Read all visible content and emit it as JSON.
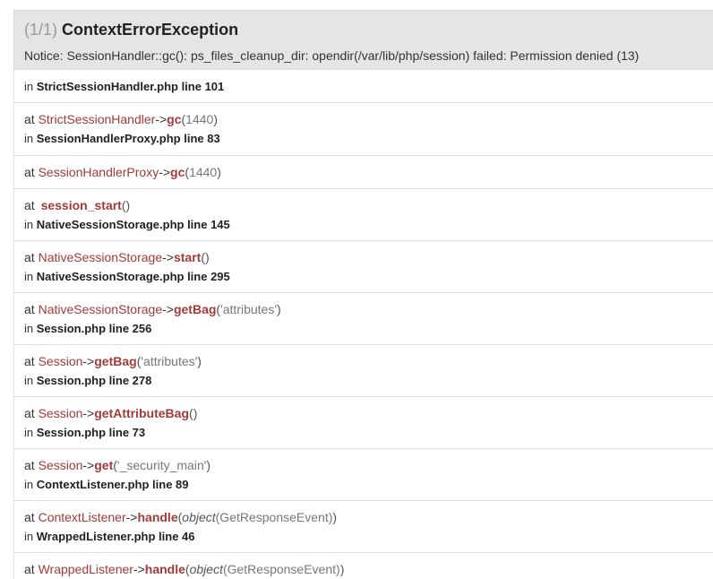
{
  "exception": {
    "count": "(1/1)",
    "name": "ContextErrorException",
    "message": "Notice: SessionHandler::gc(): ps_files_cleanup_dir: opendir(/var/lib/php/session) failed: Permission denied (13)"
  },
  "trace": [
    {
      "prefix": "in",
      "file": "StrictSessionHandler.php line 101"
    },
    {
      "prefix": "at",
      "cls": "StrictSessionHandler",
      "arrow": "->",
      "fn": "gc",
      "open": "(",
      "arg": "1440",
      "close": ")",
      "in": "in",
      "file": "SessionHandlerProxy.php line 83"
    },
    {
      "prefix": "at",
      "cls": "SessionHandlerProxy",
      "arrow": "->",
      "fn": "gc",
      "open": "(",
      "arg": "1440",
      "close": ")"
    },
    {
      "prefix": "at",
      "fn": "session_start",
      "open": "(",
      "close": ")",
      "in": "in",
      "file": "NativeSessionStorage.php line 145"
    },
    {
      "prefix": "at",
      "cls": "NativeSessionStorage",
      "arrow": "->",
      "fn": "start",
      "open": "(",
      "close": ")",
      "in": "in",
      "file": "NativeSessionStorage.php line 295"
    },
    {
      "prefix": "at",
      "cls": "NativeSessionStorage",
      "arrow": "->",
      "fn": "getBag",
      "open": "(",
      "arg": "'attributes'",
      "close": ")",
      "in": "in",
      "file": "Session.php line 256"
    },
    {
      "prefix": "at",
      "cls": "Session",
      "arrow": "->",
      "fn": "getBag",
      "open": "(",
      "arg": "'attributes'",
      "close": ")",
      "in": "in",
      "file": "Session.php line 278"
    },
    {
      "prefix": "at",
      "cls": "Session",
      "arrow": "->",
      "fn": "getAttributeBag",
      "open": "(",
      "close": ")",
      "in": "in",
      "file": "Session.php line 73"
    },
    {
      "prefix": "at",
      "cls": "Session",
      "arrow": "->",
      "fn": "get",
      "open": "(",
      "arg": "'_security_main'",
      "close": ")",
      "in": "in",
      "file": "ContextListener.php line 89"
    },
    {
      "prefix": "at",
      "cls": "ContextListener",
      "arrow": "->",
      "fn": "handle",
      "open": "(",
      "argObj": "object",
      "arg": "(GetResponseEvent)",
      "close": ")",
      "in": "in",
      "file": "WrappedListener.php line 46"
    },
    {
      "prefix": "at",
      "cls": "WrappedListener",
      "arrow": "->",
      "fn": "handle",
      "open": "(",
      "argObj": "object",
      "arg": "(GetResponseEvent)",
      "close": ")"
    }
  ],
  "colors": {
    "header_bg": "#e5e5e5",
    "class_color": "#a33a3a",
    "function_color": "#a33a3a",
    "border": "#dddddd"
  }
}
